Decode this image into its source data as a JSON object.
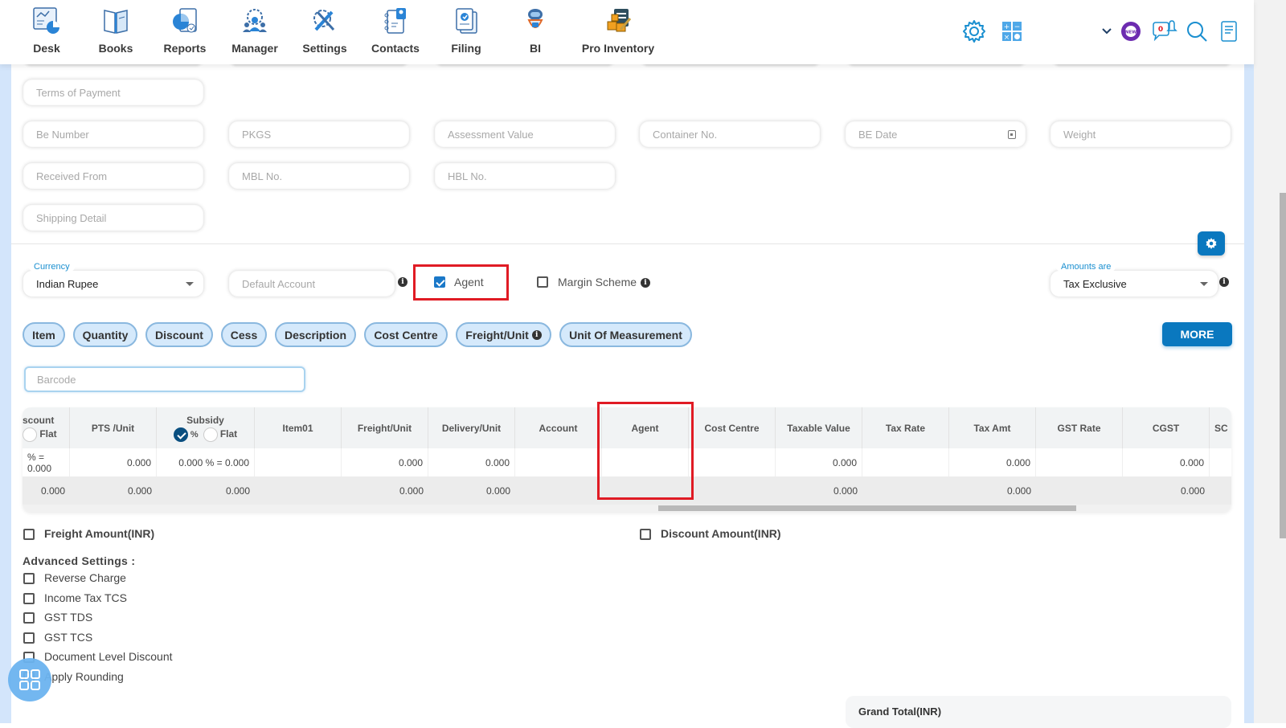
{
  "topnav": {
    "items": [
      {
        "label": "Desk",
        "icon": "desk-icon"
      },
      {
        "label": "Books",
        "icon": "books-icon"
      },
      {
        "label": "Reports",
        "icon": "reports-icon"
      },
      {
        "label": "Manager",
        "icon": "manager-icon"
      },
      {
        "label": "Settings",
        "icon": "settings-icon"
      },
      {
        "label": "Contacts",
        "icon": "contacts-icon"
      },
      {
        "label": "Filing",
        "icon": "filing-icon"
      },
      {
        "label": "BI",
        "icon": "bi-robot-icon"
      },
      {
        "label": "Pro Inventory",
        "icon": "pro-inventory-icon"
      }
    ],
    "right_icons": [
      "gear-icon",
      "calculator-icon",
      "chevron-down-icon",
      "new-badge-icon",
      "notification-icon",
      "search-icon",
      "notes-icon"
    ],
    "notification_count": "0",
    "new_badge_text": "NEW"
  },
  "form": {
    "fields": {
      "terms_of_payment": "Terms of Payment",
      "be_number": "Be Number",
      "pkgs": "PKGS",
      "assessment_value": "Assessment Value",
      "container_no": "Container No.",
      "be_date": "BE Date",
      "weight": "Weight",
      "received_from": "Received From",
      "mbl_no": "MBL No.",
      "hbl_no": "HBL No.",
      "shipping_detail": "Shipping Detail"
    },
    "currency": {
      "label": "Currency",
      "value": "Indian Rupee"
    },
    "default_account": {
      "placeholder": "Default Account"
    },
    "agent": {
      "label": "Agent",
      "checked": true
    },
    "margin_scheme": {
      "label": "Margin Scheme",
      "checked": false
    },
    "amounts_are": {
      "label": "Amounts are",
      "value": "Tax Exclusive"
    }
  },
  "chips": [
    "Item",
    "Quantity",
    "Discount",
    "Cess",
    "Description",
    "Cost Centre",
    "Freight/Unit",
    "Unit Of Measurement"
  ],
  "more_label": "MORE",
  "barcode": {
    "placeholder": "Barcode"
  },
  "table": {
    "columns": [
      {
        "label": "scount",
        "sub": "Flat"
      },
      {
        "label": "PTS /Unit"
      },
      {
        "label": "Subsidy",
        "sub_pct": "%",
        "sub_flat": "Flat"
      },
      {
        "label": "Item01"
      },
      {
        "label": "Freight/Unit"
      },
      {
        "label": "Delivery/Unit"
      },
      {
        "label": "Account"
      },
      {
        "label": "Agent"
      },
      {
        "label": "Cost Centre"
      },
      {
        "label": "Taxable Value"
      },
      {
        "label": "Tax Rate"
      },
      {
        "label": "Tax Amt"
      },
      {
        "label": "GST Rate"
      },
      {
        "label": "CGST"
      },
      {
        "label": "SC"
      }
    ],
    "row": [
      "% = 0.000",
      "0.000",
      "0.000 % = 0.000",
      "",
      "0.000",
      "0.000",
      "",
      "",
      "",
      "0.000",
      "",
      "0.000",
      "",
      "0.000",
      ""
    ],
    "totals": [
      "0.000",
      "0.000",
      "0.000",
      "",
      "0.000",
      "0.000",
      "",
      "",
      "",
      "0.000",
      "",
      "0.000",
      "",
      "0.000",
      ""
    ]
  },
  "options": {
    "freight_amount": "Freight Amount(INR)",
    "discount_amount": "Discount Amount(INR)",
    "advanced_title": "Advanced Settings :",
    "advanced": [
      "Reverse Charge",
      "Income Tax TCS",
      "GST TDS",
      "GST TCS",
      "Document Level Discount",
      "Apply Rounding"
    ]
  },
  "grand_total_label": "Grand Total(INR)",
  "colors": {
    "accent": "#0a78bf",
    "chip_bg": "#d5e9fb",
    "highlight": "#e01b24",
    "label_blue": "#1a8fd0"
  }
}
